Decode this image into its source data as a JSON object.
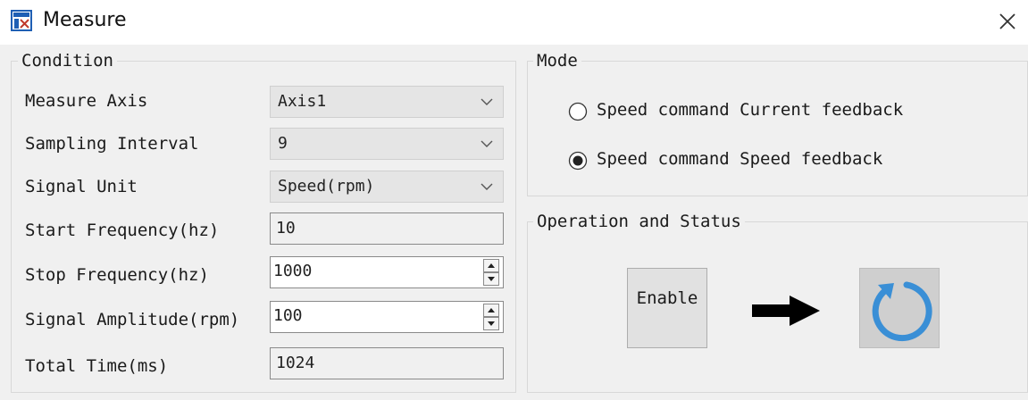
{
  "window": {
    "title": "Measure"
  },
  "condition": {
    "legend": "Condition",
    "rows": [
      {
        "label": "Measure Axis",
        "kind": "select",
        "value": "Axis1"
      },
      {
        "label": "Sampling Interval",
        "kind": "select",
        "value": "9"
      },
      {
        "label": "Signal Unit",
        "kind": "select",
        "value": "Speed(rpm)"
      },
      {
        "label": "Start Frequency(hz)",
        "kind": "readonly",
        "value": "10"
      },
      {
        "label": "Stop Frequency(hz)",
        "kind": "spin",
        "value": "1000"
      },
      {
        "label": "Signal Amplitude(rpm)",
        "kind": "spin",
        "value": "100"
      },
      {
        "label": "Total Time(ms)",
        "kind": "readonly",
        "value": "1024"
      }
    ]
  },
  "mode": {
    "legend": "Mode",
    "options": [
      {
        "label": "Speed command Current feedback",
        "selected": false
      },
      {
        "label": "Speed command Speed feedback",
        "selected": true
      }
    ]
  },
  "operation": {
    "legend": "Operation and Status",
    "enable_label": "Enable",
    "arrow_icon": "right-arrow-icon",
    "status_icon": "refresh-icon"
  },
  "colors": {
    "refresh_blue": "#3a8fd6",
    "window_bg": "#f0f0f0"
  }
}
